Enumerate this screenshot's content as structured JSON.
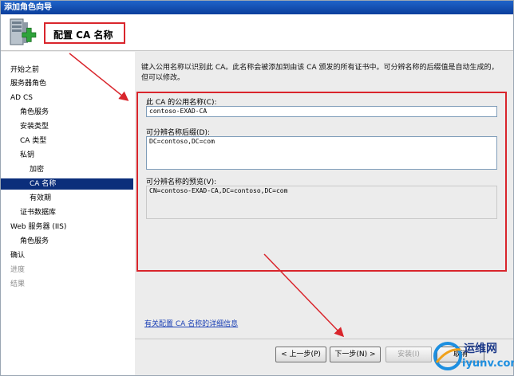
{
  "window": {
    "title": "添加角色向导"
  },
  "header": {
    "title": "配置 CA 名称",
    "icon": "server-add-icon"
  },
  "sidebar": {
    "items": [
      {
        "label": "开始之前",
        "state": "normal"
      },
      {
        "label": "服务器角色",
        "state": "normal"
      },
      {
        "label": "AD CS",
        "state": "normal"
      },
      {
        "label": "角色服务",
        "state": "normal"
      },
      {
        "label": "安装类型",
        "state": "normal"
      },
      {
        "label": "CA 类型",
        "state": "normal"
      },
      {
        "label": "私钥",
        "state": "normal"
      },
      {
        "label": "加密",
        "state": "normal"
      },
      {
        "label": "CA 名称",
        "state": "active"
      },
      {
        "label": "有效期",
        "state": "normal"
      },
      {
        "label": "证书数据库",
        "state": "normal"
      },
      {
        "label": "Web 服务器 (IIS)",
        "state": "normal"
      },
      {
        "label": "角色服务",
        "state": "normal"
      },
      {
        "label": "确认",
        "state": "normal"
      },
      {
        "label": "进度",
        "state": "disabled"
      },
      {
        "label": "结果",
        "state": "disabled"
      }
    ]
  },
  "main": {
    "description": "键入公用名称以识别此 CA。此名称会被添加到由该 CA 颁发的所有证书中。可分辨名称的后缀值是自动生成的，但可以修改。",
    "common_name": {
      "label": "此 CA 的公用名称(C):",
      "value": "contoso-EXAD-CA"
    },
    "dn_suffix": {
      "label": "可分辨名称后缀(D):",
      "value": "DC=contoso,DC=com"
    },
    "dn_preview": {
      "label": "可分辨名称的预览(V):",
      "value": "CN=contoso-EXAD-CA,DC=contoso,DC=com"
    },
    "help_link": "有关配置 CA 名称的详细信息"
  },
  "footer": {
    "back": "< 上一步(P)",
    "next": "下一步(N) >",
    "install": "安装(I)",
    "cancel": "取消"
  },
  "watermark": {
    "text1": "运维网",
    "text2": "iyunv.com"
  },
  "colors": {
    "highlight": "#d9252c",
    "active_nav": "#0b2e7b",
    "link": "#1a3fb5"
  }
}
